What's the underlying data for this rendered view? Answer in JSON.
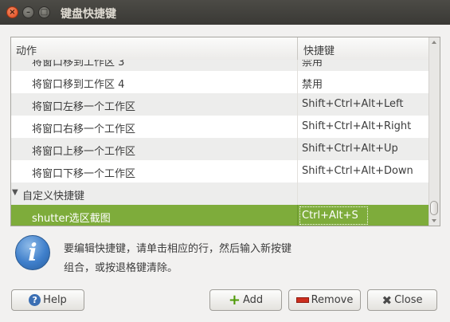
{
  "window": {
    "title": "键盘快捷键"
  },
  "table": {
    "headers": {
      "action": "动作",
      "shortcut": "快捷键"
    },
    "rows": [
      {
        "action": "将窗口移到工作区 3",
        "shortcut": "禁用"
      },
      {
        "action": "将窗口移到工作区 4",
        "shortcut": "禁用"
      },
      {
        "action": "将窗口左移一个工作区",
        "shortcut": "Shift+Ctrl+Alt+Left"
      },
      {
        "action": "将窗口右移一个工作区",
        "shortcut": "Shift+Ctrl+Alt+Right"
      },
      {
        "action": "将窗口上移一个工作区",
        "shortcut": "Shift+Ctrl+Alt+Up"
      },
      {
        "action": "将窗口下移一个工作区",
        "shortcut": "Shift+Ctrl+Alt+Down"
      },
      {
        "action": "自定义快捷键",
        "shortcut": ""
      },
      {
        "action": "shutter选区截图",
        "shortcut": "Ctrl+Alt+S"
      }
    ]
  },
  "info": {
    "text_line1": "要编辑快捷键，请单击相应的行，然后输入新按键",
    "text_line2": "组合，或按退格键清除。"
  },
  "buttons": {
    "help": "Help",
    "add": "Add",
    "remove": "Remove",
    "close": "Close"
  },
  "colors": {
    "selected_row": "#7eac3b",
    "titlebar": "#3c3b37"
  }
}
